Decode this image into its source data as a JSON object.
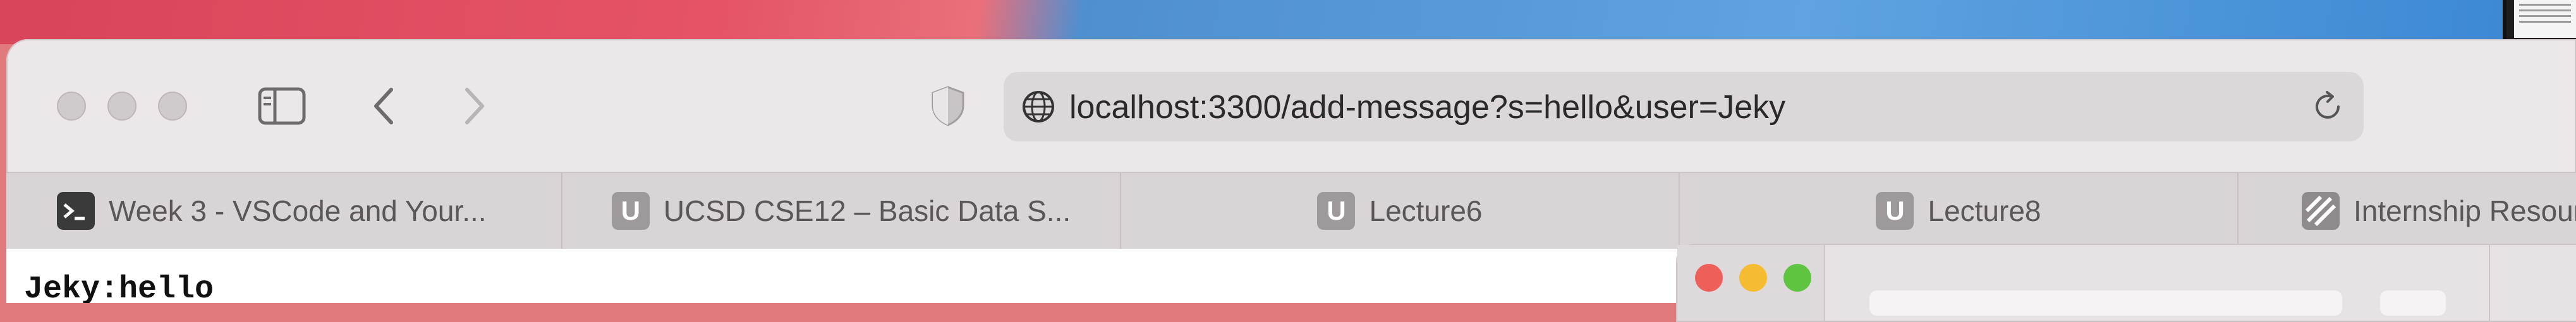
{
  "browser": {
    "url": "localhost:3300/add-message?s=hello&user=Jeky",
    "tabs": [
      {
        "label": "Week 3 - VSCode and Your...",
        "favicon": "terminal-icon"
      },
      {
        "label": "UCSD CSE12 – Basic Data S...",
        "favicon": "U"
      },
      {
        "label": "Lecture6",
        "favicon": "U"
      },
      {
        "label": "Lecture8",
        "favicon": "U"
      },
      {
        "label": "Internship Resour",
        "favicon": "stripes-icon"
      }
    ]
  },
  "page": {
    "text": "Jeky:hello"
  },
  "colors": {
    "traffic_red": "#ee5f57",
    "traffic_yellow": "#f5bc32",
    "traffic_green": "#5fc440"
  }
}
